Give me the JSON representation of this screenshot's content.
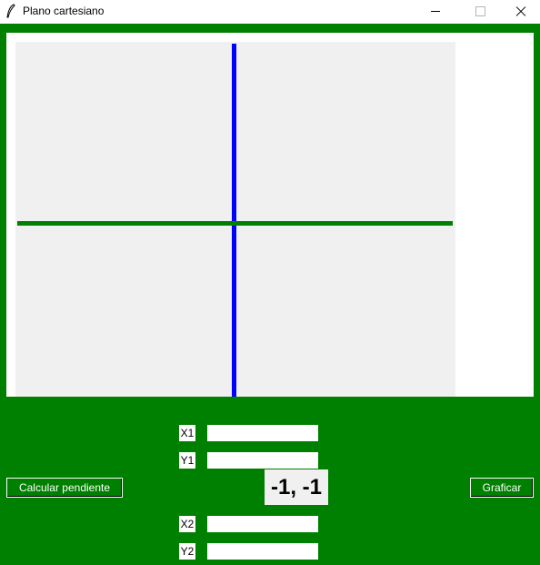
{
  "window": {
    "title": "Plano cartesiano",
    "icon": "feather-icon"
  },
  "colors": {
    "background": "#008000",
    "y_axis": "#0000ff",
    "x_axis": "#008000",
    "plane": "#f0f0f0"
  },
  "form": {
    "x1": {
      "label": "X1",
      "value": ""
    },
    "y1": {
      "label": "Y1",
      "value": ""
    },
    "x2": {
      "label": "X2",
      "value": ""
    },
    "y2": {
      "label": "Y2",
      "value": ""
    }
  },
  "buttons": {
    "slope": "Calcular pendiente",
    "plot": "Graficar"
  },
  "result": "-1, -1"
}
